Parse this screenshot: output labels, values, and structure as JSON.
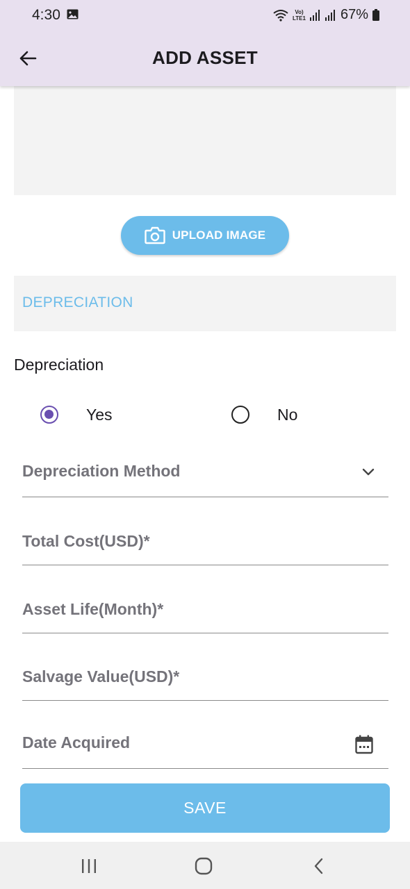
{
  "status_bar": {
    "time": "4:30",
    "volte_line1": "Vo)",
    "volte_line2": "LTE1",
    "battery": "67%"
  },
  "app_bar": {
    "title": "ADD ASSET",
    "back_icon": "arrow-left-icon"
  },
  "upload": {
    "label": "UPLOAD IMAGE",
    "icon": "camera-icon"
  },
  "section": {
    "header": "DEPRECIATION"
  },
  "depreciation": {
    "label": "Depreciation",
    "options": [
      {
        "label": "Yes",
        "selected": true
      },
      {
        "label": "No",
        "selected": false
      }
    ]
  },
  "fields": {
    "method": {
      "placeholder": "Depreciation Method",
      "icon": "chevron-down-icon"
    },
    "total_cost": {
      "placeholder": "Total Cost(USD)*"
    },
    "asset_life": {
      "placeholder": "Asset Life(Month)*"
    },
    "salvage_value": {
      "placeholder": "Salvage Value(USD)*"
    },
    "date_acquired": {
      "placeholder": "Date Acquired",
      "icon": "calendar-icon"
    }
  },
  "actions": {
    "save_label": "SAVE"
  },
  "colors": {
    "accent": "#6cbcea",
    "radio_selected": "#6a4fb0",
    "app_bar_bg": "#e8e0ef"
  }
}
